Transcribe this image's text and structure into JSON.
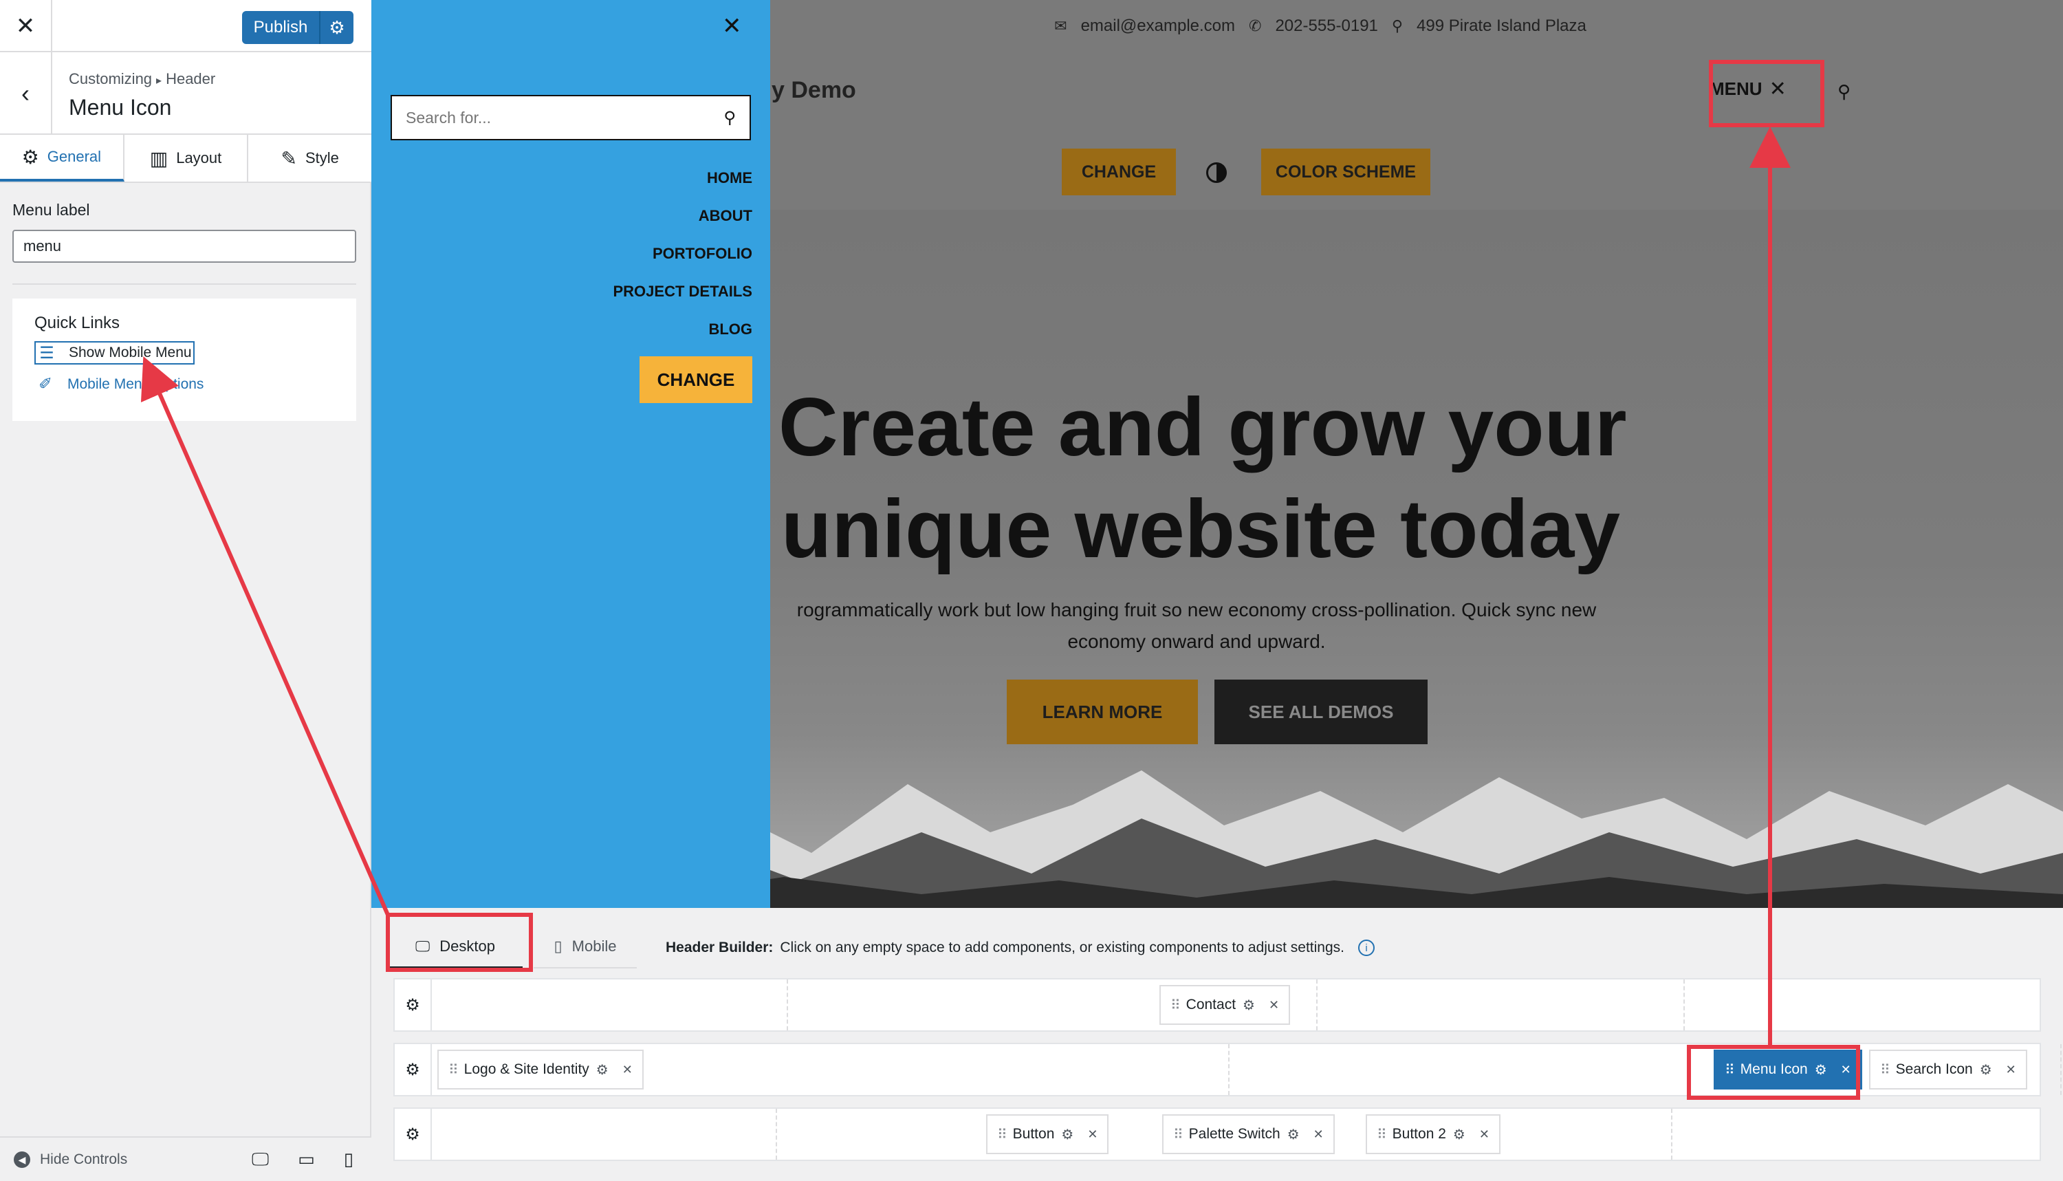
{
  "panel": {
    "close_icon": "close-icon",
    "publish_label": "Publish",
    "breadcrumb_root": "Customizing",
    "breadcrumb_sep": "▸",
    "breadcrumb_section": "Header",
    "section_title": "Menu Icon",
    "tabs": [
      {
        "label": "General",
        "icon": "gear-icon"
      },
      {
        "label": "Layout",
        "icon": "layout-icon"
      },
      {
        "label": "Style",
        "icon": "brush-icon"
      }
    ],
    "menu_label_title": "Menu label",
    "menu_label_value": "menu",
    "quick_links_title": "Quick Links",
    "quick_links": [
      {
        "label": "Show Mobile Menu",
        "icon": "mobile-menu-icon"
      },
      {
        "label": "Mobile Menu Options",
        "icon": "pin-icon"
      }
    ],
    "hide_controls": "Hide Controls"
  },
  "preview": {
    "email": "email@example.com",
    "phone": "202-555-0191",
    "address": "499 Pirate Island Plaza",
    "site_title_fragment": "y Demo",
    "menu_label": "MENU",
    "change_label": "CHANGE",
    "color_scheme_label": "COLOR SCHEME",
    "hero_line1": "Create and grow your",
    "hero_line2": "unique website today",
    "hero_sub": "rogrammatically work but low hanging fruit so new economy cross-pollination. Quick sync new economy onward and upward.",
    "learn_more": "LEARN MORE",
    "see_all_demos": "SEE ALL DEMOS",
    "drawer": {
      "search_placeholder": "Search for...",
      "menu_items": [
        "HOME",
        "ABOUT",
        "PORTOFOLIO",
        "PROJECT DETAILS",
        "BLOG"
      ],
      "change_label": "CHANGE"
    }
  },
  "builder": {
    "tab_desktop": "Desktop",
    "tab_mobile": "Mobile",
    "hint_bold": "Header Builder:",
    "hint_text": "Click on any empty space to add components, or existing components to adjust settings.",
    "chips": {
      "contact": "Contact",
      "logo": "Logo & Site Identity",
      "menu_icon": "Menu Icon",
      "search_icon": "Search Icon",
      "button": "Button",
      "palette": "Palette Switch",
      "button2": "Button 2"
    }
  },
  "colors": {
    "accent": "#2271b1",
    "drawer_blue": "#35a1e0",
    "gold": "#9a6b15",
    "annotation_red": "#e63946"
  }
}
